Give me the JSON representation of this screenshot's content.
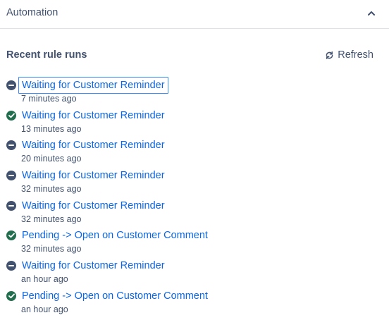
{
  "header": {
    "title": "Automation",
    "collapse_icon": "chevron-up-icon"
  },
  "subheader": {
    "title": "Recent rule runs",
    "refresh_label": "Refresh",
    "refresh_icon": "refresh-icon"
  },
  "colors": {
    "link": "#0c66e4",
    "text": "#42526e",
    "success": "#216e4e",
    "no_action": "#42526e"
  },
  "runs": [
    {
      "name": "Waiting for Customer Reminder",
      "time": "7 minutes ago",
      "status": "no-action"
    },
    {
      "name": "Waiting for Customer Reminder",
      "time": "13 minutes ago",
      "status": "success"
    },
    {
      "name": "Waiting for Customer Reminder",
      "time": "20 minutes ago",
      "status": "no-action"
    },
    {
      "name": "Waiting for Customer Reminder",
      "time": "32 minutes ago",
      "status": "no-action"
    },
    {
      "name": "Waiting for Customer Reminder",
      "time": "32 minutes ago",
      "status": "no-action"
    },
    {
      "name": "Pending -> Open on Customer Comment",
      "time": "32 minutes ago",
      "status": "success"
    },
    {
      "name": "Waiting for Customer Reminder",
      "time": "an hour ago",
      "status": "no-action"
    },
    {
      "name": "Pending -> Open on Customer Comment",
      "time": "an hour ago",
      "status": "success"
    }
  ]
}
